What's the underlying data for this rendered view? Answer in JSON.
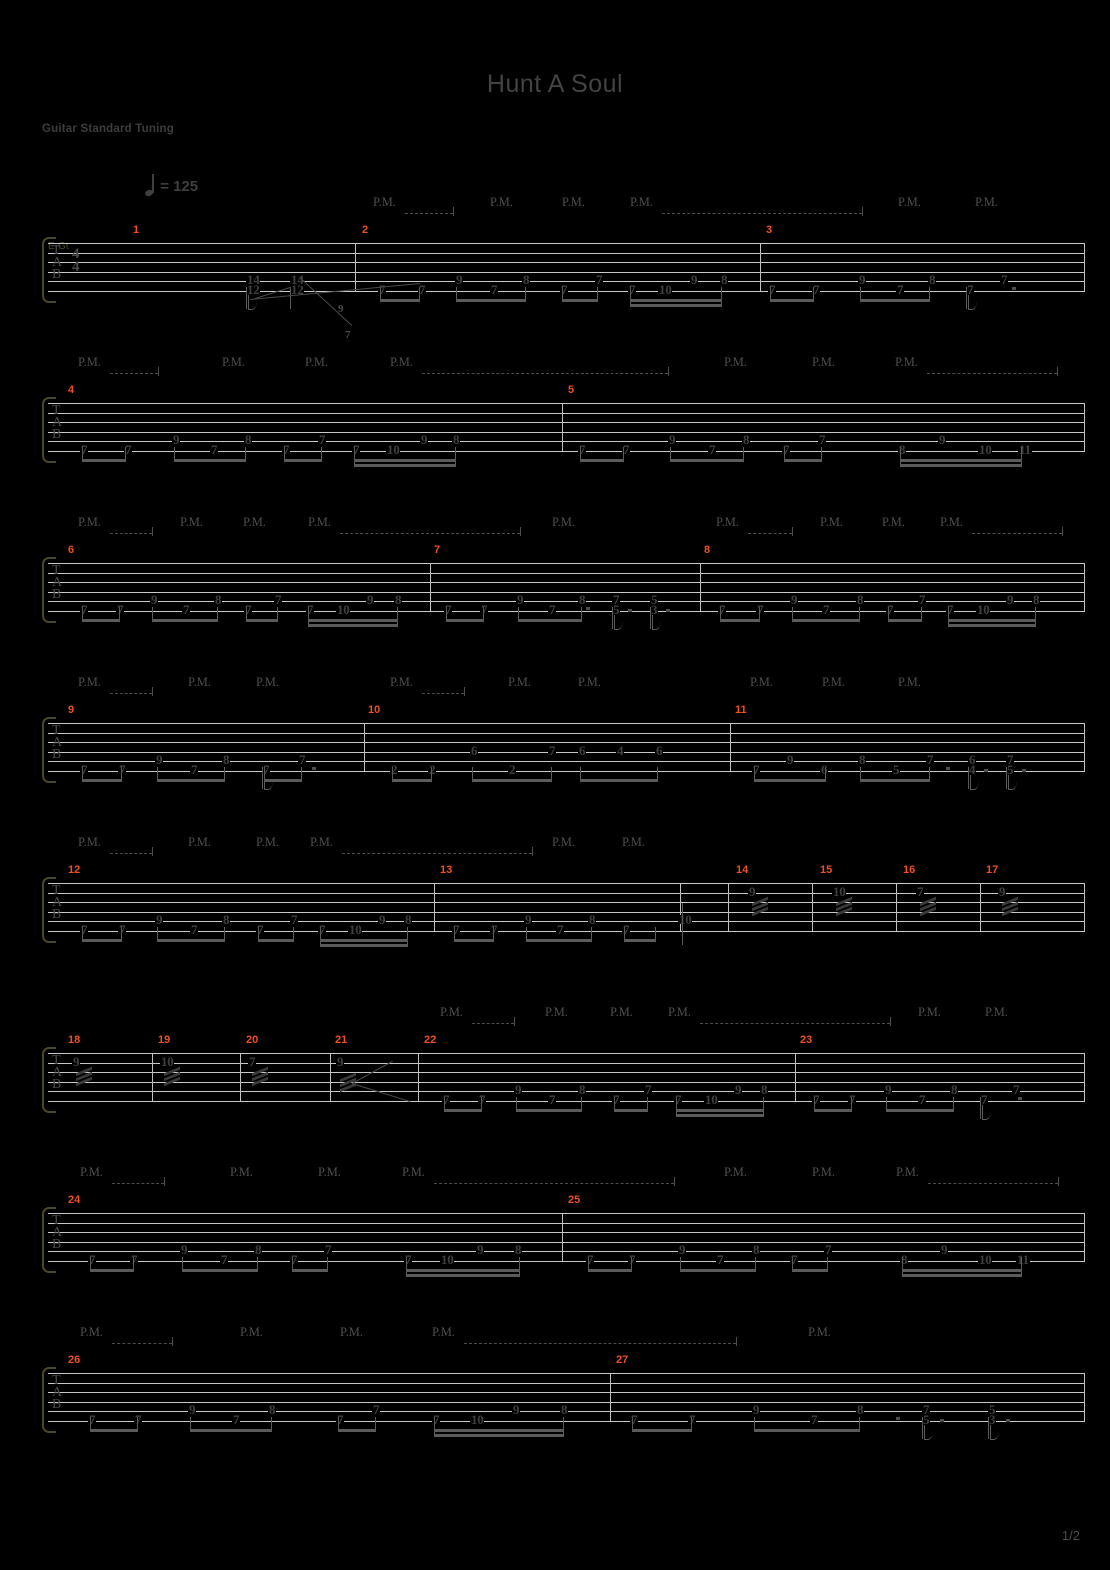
{
  "document": {
    "title": "Hunt A Soul",
    "tuning": "Guitar Standard Tuning",
    "tempo_label": "= 125",
    "tempo_bpm": 125,
    "page_indicator": "1/2",
    "instrument_label": "E-Gt",
    "tab_letters": "TAB",
    "time_signature": {
      "numerator": "4",
      "denominator": "4"
    },
    "palm_mute_label": "P.M."
  },
  "colors": {
    "background": "#000000",
    "staff_line": "#c9c9c9",
    "tab_number": "#3f3f3f",
    "measure_number": "#ef4f1e",
    "title": "#434343",
    "brace": "#4a4724"
  },
  "systems": [
    {
      "index": 1,
      "measure_numbers": [
        "1",
        "2",
        "3"
      ],
      "palm_mutes": [
        "P.M.",
        "P.M.",
        "P.M.",
        "P.M.",
        "P.M.",
        "P.M."
      ],
      "notes": [
        "14",
        "12",
        "14",
        "12",
        "9",
        "7",
        "7",
        "7",
        "9",
        "7",
        "8",
        "7",
        "7",
        "7",
        "10",
        "9",
        "8",
        "7",
        "7",
        "9",
        "7",
        "8",
        "7",
        "7"
      ]
    },
    {
      "index": 2,
      "measure_numbers": [
        "4",
        "5"
      ],
      "palm_mutes": [
        "P.M.",
        "P.M.",
        "P.M.",
        "P.M.",
        "P.M.",
        "P.M.",
        "P.M."
      ],
      "notes": [
        "7",
        "7",
        "9",
        "7",
        "8",
        "7",
        "7",
        "7",
        "10",
        "9",
        "8",
        "7",
        "7",
        "9",
        "7",
        "8",
        "7",
        "7",
        "8",
        "9",
        "10",
        "11"
      ]
    },
    {
      "index": 3,
      "measure_numbers": [
        "6",
        "7",
        "8"
      ],
      "palm_mutes": [
        "P.M.",
        "P.M.",
        "P.M.",
        "P.M.",
        "P.M.",
        "P.M.",
        "P.M.",
        "P.M.",
        "P.M."
      ],
      "notes": [
        "7",
        "7",
        "9",
        "7",
        "8",
        "7",
        "7",
        "7",
        "10",
        "9",
        "8",
        "7",
        "7",
        "9",
        "7",
        "8",
        "7",
        "5",
        "7",
        "5",
        "5",
        "3",
        "7",
        "7",
        "9",
        "7",
        "8",
        "7",
        "7",
        "7",
        "10",
        "9",
        "8"
      ]
    },
    {
      "index": 4,
      "measure_numbers": [
        "9",
        "10",
        "11"
      ],
      "palm_mutes": [
        "P.M.",
        "P.M.",
        "P.M.",
        "P.M.",
        "P.M.",
        "P.M.",
        "P.M.",
        "P.M.",
        "P.M."
      ],
      "notes": [
        "7",
        "7",
        "9",
        "7",
        "8",
        "7",
        "7",
        "2",
        "2",
        "6",
        "2",
        "7",
        "2",
        "6",
        "4",
        "6",
        "7",
        "9",
        "6",
        "8",
        "5",
        "7",
        "6",
        "4",
        "7",
        "5"
      ]
    },
    {
      "index": 5,
      "measure_numbers": [
        "12",
        "13",
        "14",
        "15",
        "16",
        "17"
      ],
      "palm_mutes": [
        "P.M.",
        "P.M.",
        "P.M.",
        "P.M.",
        "P.M.",
        "P.M."
      ],
      "notes": [
        "7",
        "7",
        "9",
        "7",
        "8",
        "7",
        "7",
        "7",
        "10",
        "9",
        "8",
        "7",
        "7",
        "9",
        "7",
        "8",
        "7",
        "10",
        "9",
        "10",
        "7",
        "9"
      ]
    },
    {
      "index": 6,
      "measure_numbers": [
        "18",
        "19",
        "20",
        "21",
        "22",
        "23"
      ],
      "palm_mutes": [
        "P.M.",
        "P.M.",
        "P.M.",
        "P.M.",
        "P.M.",
        "P.M."
      ],
      "notes": [
        "9",
        "10",
        "7",
        "9",
        "7",
        "7",
        "9",
        "7",
        "8",
        "7",
        "7",
        "7",
        "10",
        "9",
        "8",
        "7",
        "7",
        "9",
        "7",
        "8",
        "7",
        "7"
      ]
    },
    {
      "index": 7,
      "measure_numbers": [
        "24",
        "25"
      ],
      "palm_mutes": [
        "P.M.",
        "P.M.",
        "P.M.",
        "P.M.",
        "P.M.",
        "P.M.",
        "P.M."
      ],
      "notes": [
        "7",
        "7",
        "9",
        "7",
        "8",
        "7",
        "7",
        "7",
        "10",
        "9",
        "8",
        "7",
        "7",
        "9",
        "7",
        "8",
        "7",
        "7",
        "8",
        "9",
        "10",
        "11"
      ]
    },
    {
      "index": 8,
      "measure_numbers": [
        "26",
        "27"
      ],
      "palm_mutes": [
        "P.M.",
        "P.M.",
        "P.M.",
        "P.M.",
        "P.M."
      ],
      "notes": [
        "7",
        "7",
        "9",
        "7",
        "8",
        "7",
        "7",
        "7",
        "10",
        "9",
        "8",
        "7",
        "7",
        "9",
        "7",
        "8",
        "7",
        "5",
        "5",
        "3"
      ]
    }
  ]
}
